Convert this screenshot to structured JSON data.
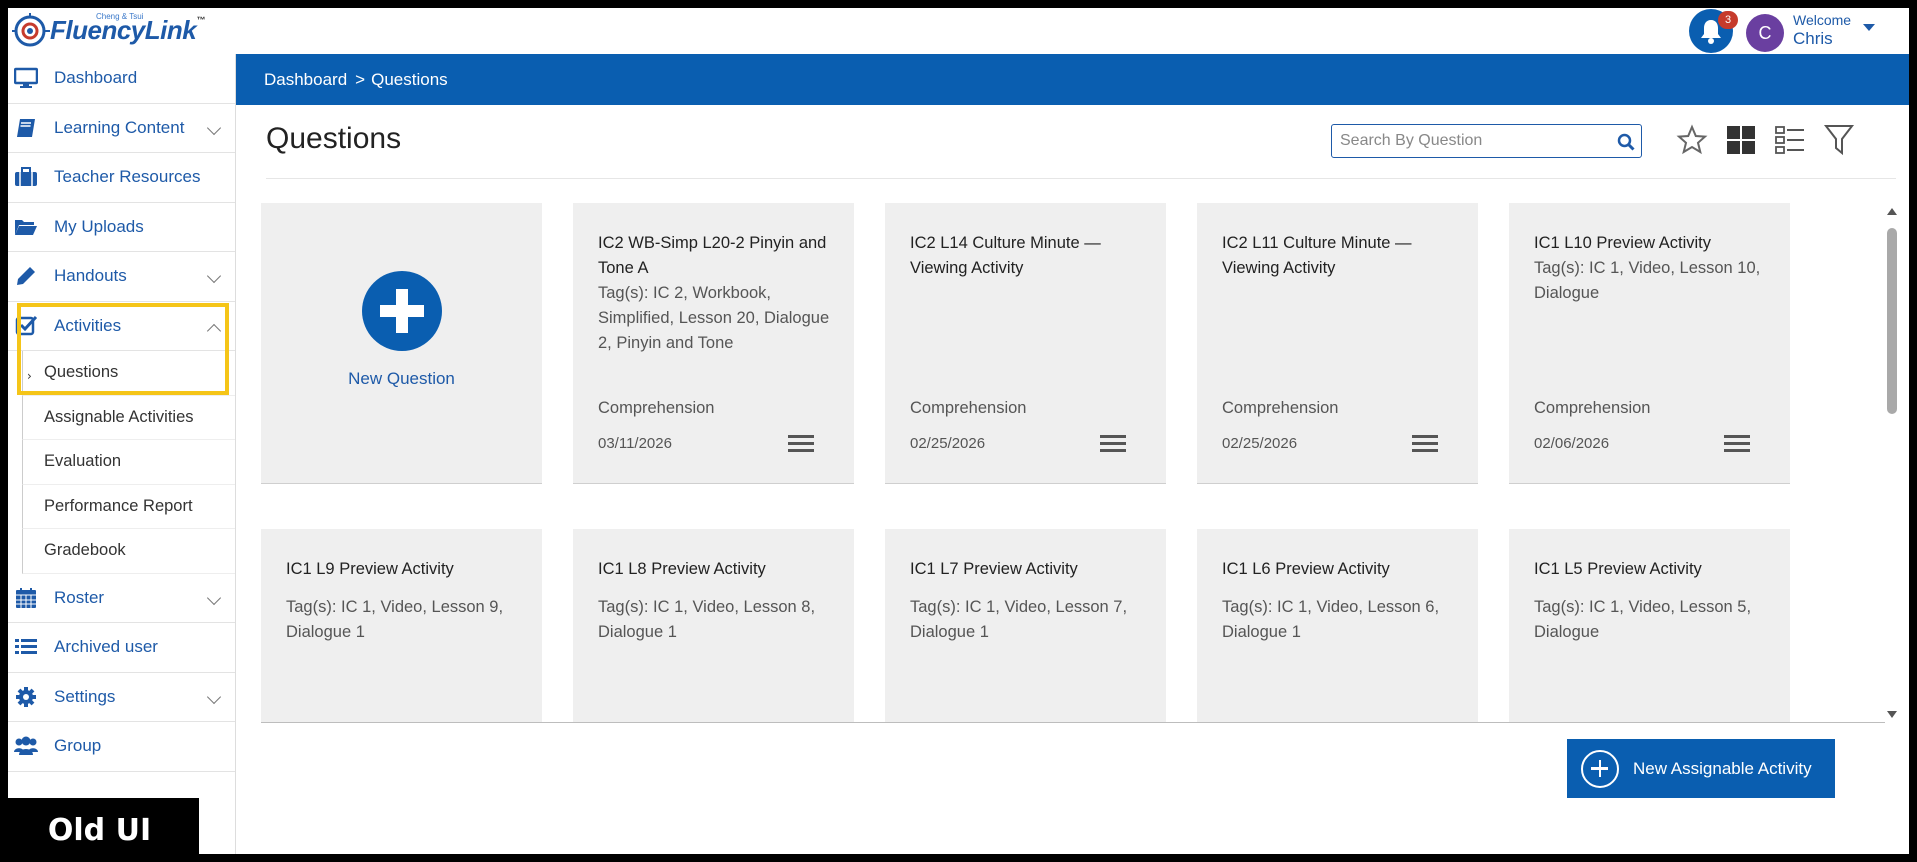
{
  "app": {
    "brand": "FluencyLink",
    "brand_sub": "Cheng & Tsui",
    "trademark": "™"
  },
  "header": {
    "notifications_count": "3",
    "avatar_initial": "C",
    "welcome_label": "Welcome",
    "user_name": "Chris"
  },
  "sidebar": {
    "items": [
      {
        "label": "Dashboard",
        "icon": "monitor-icon"
      },
      {
        "label": "Learning Content",
        "icon": "book-icon"
      },
      {
        "label": "Teacher Resources",
        "icon": "briefcase-icon"
      },
      {
        "label": "My Uploads",
        "icon": "folder-open-icon"
      },
      {
        "label": "Handouts",
        "icon": "pencil-icon"
      },
      {
        "label": "Activities",
        "icon": "checkbox-icon"
      }
    ],
    "activities_sub": [
      {
        "label": "Questions"
      },
      {
        "label": "Assignable Activities"
      },
      {
        "label": "Evaluation"
      },
      {
        "label": "Performance Report"
      },
      {
        "label": "Gradebook"
      }
    ],
    "items_after": [
      {
        "label": "Roster",
        "icon": "calendar-icon"
      },
      {
        "label": "Archived user",
        "icon": "list-icon"
      },
      {
        "label": "Settings",
        "icon": "gear-icon"
      },
      {
        "label": "Group",
        "icon": "users-icon"
      }
    ]
  },
  "overlay": {
    "label": "Old UI"
  },
  "breadcrumb": {
    "root": "Dashboard",
    "separator": ">",
    "current": "Questions"
  },
  "main": {
    "title": "Questions",
    "search_placeholder": "Search By Question",
    "new_question_label": "New Question",
    "new_assignable_activity_label": "New Assignable Activity"
  },
  "cards": [
    {
      "title": "IC2 WB-Simp L20-2 Pinyin and Tone A",
      "tags": "Tag(s): IC 2, Workbook, Simplified, Lesson 20, Dialogue 2, Pinyin and Tone",
      "category": "Comprehension",
      "date": "03/11/2026"
    },
    {
      "title": "IC2 L14 Culture Minute — Viewing Activity",
      "tags": "",
      "category": "Comprehension",
      "date": "02/25/2026"
    },
    {
      "title": "IC2 L11 Culture Minute — Viewing Activity",
      "tags": "",
      "category": "Comprehension",
      "date": "02/25/2026"
    },
    {
      "title": "IC1 L10 Preview Activity",
      "tags": "Tag(s): IC 1, Video, Lesson 10, Dialogue",
      "category": "Comprehension",
      "date": "02/06/2026"
    },
    {
      "title": "IC1 L9 Preview Activity",
      "tags": "Tag(s): IC 1, Video, Lesson 9, Dialogue 1",
      "category": "",
      "date": ""
    },
    {
      "title": "IC1 L8 Preview Activity",
      "tags": "Tag(s): IC 1, Video, Lesson 8, Dialogue 1",
      "category": "",
      "date": ""
    },
    {
      "title": "IC1 L7 Preview Activity",
      "tags": "Tag(s): IC 1, Video, Lesson 7, Dialogue 1",
      "category": "",
      "date": ""
    },
    {
      "title": "IC1 L6 Preview Activity",
      "tags": "Tag(s): IC 1, Video, Lesson 6, Dialogue 1",
      "category": "",
      "date": ""
    },
    {
      "title": "IC1 L5 Preview Activity",
      "tags": "Tag(s): IC 1, Video, Lesson 5, Dialogue",
      "category": "",
      "date": ""
    }
  ],
  "colors": {
    "primary": "#0a5eb0",
    "link": "#1e5aa8",
    "card_bg": "#efefef",
    "highlight": "#f5c518",
    "badge": "#c63b2c",
    "avatar": "#6a3fa0"
  }
}
